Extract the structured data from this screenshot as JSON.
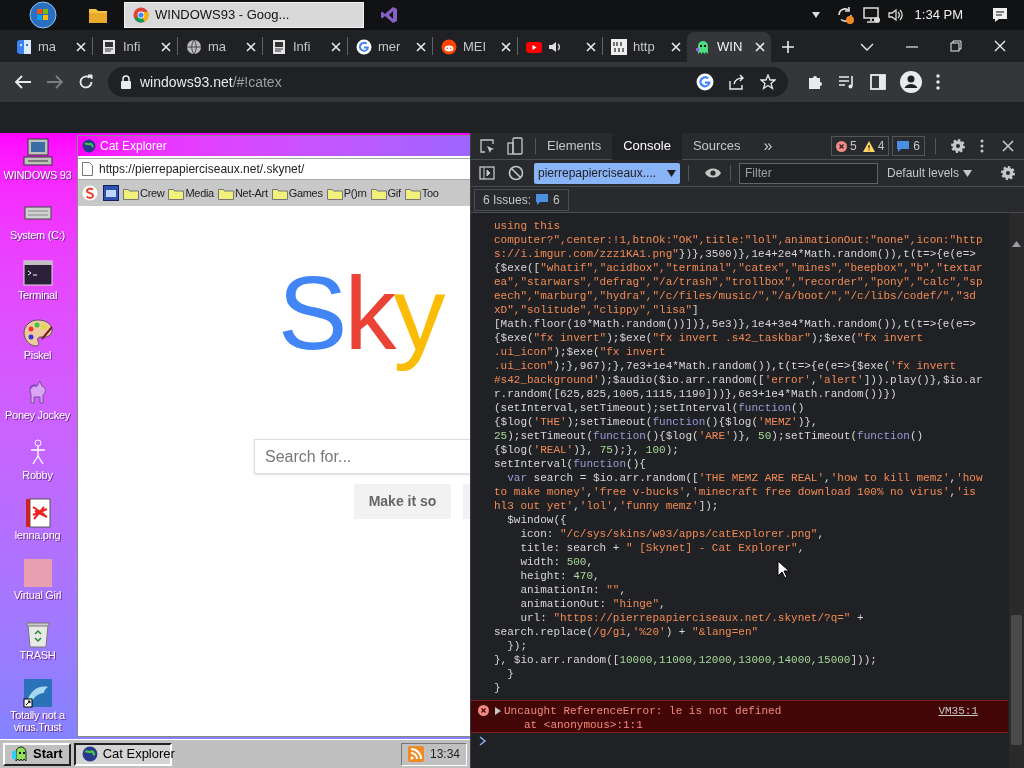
{
  "os_taskbar": {
    "window_button": "WINDOWS93 - Goog...",
    "clock": "1:34 PM"
  },
  "browser": {
    "tabs": [
      {
        "label": "ma",
        "kind": "finder",
        "audio": false,
        "selected": false
      },
      {
        "label": "Infi",
        "kind": "book",
        "audio": false,
        "selected": false
      },
      {
        "label": "ma",
        "kind": "globe",
        "audio": false,
        "selected": false
      },
      {
        "label": "Infi",
        "kind": "book",
        "audio": false,
        "selected": false
      },
      {
        "label": "mer",
        "kind": "google",
        "audio": false,
        "selected": false
      },
      {
        "label": "MEI",
        "kind": "reddit",
        "audio": false,
        "selected": false
      },
      {
        "kind": "youtube",
        "audio": true,
        "selected": false
      },
      {
        "label": "http",
        "kind": "binary",
        "audio": false,
        "selected": false
      },
      {
        "label": "WIN",
        "kind": "ghost",
        "audio": false,
        "selected": true
      }
    ],
    "address": {
      "host": "windows93.net",
      "path": "/#!catex"
    }
  },
  "desktop": {
    "icons": [
      {
        "label": "WINDOWS 93",
        "kind": "computer"
      },
      {
        "label": "System (C:)",
        "kind": "drive"
      },
      {
        "label": "Terminal",
        "kind": "terminal"
      },
      {
        "label": "Piskel",
        "kind": "palette"
      },
      {
        "label": "Poney Jockey",
        "kind": "pony"
      },
      {
        "label": "Robby",
        "kind": "robot"
      },
      {
        "label": "lenna.png",
        "kind": "image"
      },
      {
        "label": "Virtual Girl",
        "kind": "photo"
      },
      {
        "label": "TRASH",
        "kind": "trash"
      },
      {
        "label": "Totally not a virus.Trust",
        "kind": "dolphin"
      }
    ]
  },
  "cat_explorer": {
    "title": "Cat Explorer",
    "url": "https://pierrepapierciseaux.net/.skynet/",
    "bookmarks": [
      {
        "kind": "s-logo"
      },
      {
        "kind": "app"
      },
      {
        "kind": "folder",
        "label": "Crew"
      },
      {
        "kind": "folder",
        "label": "Media"
      },
      {
        "kind": "folder",
        "label": "Net-Art"
      },
      {
        "kind": "folder",
        "label": "Games"
      },
      {
        "kind": "folder",
        "label": "P()rn"
      },
      {
        "kind": "folder",
        "label": "Gif"
      },
      {
        "kind": "folder",
        "label": "Too"
      }
    ],
    "page": {
      "logo": [
        {
          "text": "S",
          "color": "#4285f4"
        },
        {
          "text": "k",
          "color": "#ea4335"
        },
        {
          "text": "y",
          "color": "#fbbc05"
        }
      ],
      "search_placeholder": "Search for...",
      "button": "Make it so"
    }
  },
  "taskbar": {
    "start": "Start",
    "tasks": [
      {
        "label": "Cat Explorer",
        "selected": true
      }
    ],
    "clock": "13:34"
  },
  "devtools": {
    "tabs": [
      {
        "label": "Elements",
        "selected": false
      },
      {
        "label": "Console",
        "selected": true
      },
      {
        "label": "Sources",
        "selected": false
      }
    ],
    "more": "»",
    "errors": "5",
    "warnings": "4",
    "messages": "6",
    "context": "pierrepapierciseaux....",
    "filter_placeholder": "Filter",
    "levels": "Default levels",
    "issues_label": "6 Issues:",
    "issues_count": "6",
    "console_lines": [
      [
        {
          "kind": "s",
          "text": "using this"
        }
      ],
      [
        {
          "kind": "s",
          "text": "computer?\",center:!1,btnOk:\"OK\",title:\"lol\",animationOut:\"none\",icon:\"http"
        }
      ],
      [
        {
          "kind": "s",
          "text": "s://i.imgur.com/zzz1KA1.png\""
        },
        {
          "kind": "p",
          "text": "})},3500)},1e4+2e4*Math.random()),t(t=>{e(e=>"
        }
      ],
      [
        {
          "kind": "p",
          "text": "{$exe(["
        },
        {
          "kind": "s",
          "text": "\"whatif\",\"acidbox\",\"terminal\",\"catex\",\"mines\",\"beepbox\",\"b\",\"textar"
        }
      ],
      [
        {
          "kind": "s",
          "text": "ea\",\"starwars\",\"defrag\",\"/a/trash\",\"trollbox\",\"recorder\",\"pony\",\"calc\",\"sp"
        }
      ],
      [
        {
          "kind": "s",
          "text": "eech\",\"marburg\",\"hydra\",\"/c/files/music/\",\"/a/boot/\",\"/c/libs/codef/\",\"3d"
        }
      ],
      [
        {
          "kind": "s",
          "text": "xD\",\"solitude\",\"clippy\",\"lisa\""
        },
        {
          "kind": "p",
          "text": "]"
        }
      ],
      [
        {
          "kind": "p",
          "text": "[Math.floor(10*Math.random())])},5e3)},1e4+3e4*Math.random()),t(t=>{e(e=>"
        }
      ],
      [
        {
          "kind": "p",
          "text": "{$exe("
        },
        {
          "kind": "s",
          "text": "\"fx invert\""
        },
        {
          "kind": "p",
          "text": ");$exe("
        },
        {
          "kind": "s",
          "text": "\"fx invert .s42_taskbar\""
        },
        {
          "kind": "p",
          "text": ");$exe("
        },
        {
          "kind": "s",
          "text": "\"fx invert"
        }
      ],
      [
        {
          "kind": "s",
          "text": ".ui_icon\""
        },
        {
          "kind": "p",
          "text": ");$exe("
        },
        {
          "kind": "s",
          "text": "\"fx invert"
        }
      ],
      [
        {
          "kind": "s",
          "text": ".ui_icon\""
        },
        {
          "kind": "p",
          "text": ");},967);},7e3+1e4*Math.random()),t(t=>{e(e=>{$exe("
        },
        {
          "kind": "s",
          "text": "'fx invert"
        }
      ],
      [
        {
          "kind": "s",
          "text": "#s42_background'"
        },
        {
          "kind": "p",
          "text": ");$audio($io.arr.random(["
        },
        {
          "kind": "s",
          "text": "'error'"
        },
        {
          "kind": "p",
          "text": ","
        },
        {
          "kind": "s",
          "text": "'alert'"
        },
        {
          "kind": "p",
          "text": "])).play()},$io.ar"
        }
      ],
      [
        {
          "kind": "p",
          "text": "r.random([625,825,1005,1115,1190]))},6e3+1e4*Math.random())})"
        }
      ],
      [
        {
          "kind": "p",
          "text": "(setInterval,setTimeout);setInterval("
        },
        {
          "kind": "k",
          "text": "function"
        },
        {
          "kind": "p",
          "text": "()"
        }
      ],
      [
        {
          "kind": "p",
          "text": "{$log("
        },
        {
          "kind": "s",
          "text": "'THE'"
        },
        {
          "kind": "p",
          "text": ");setTimeout("
        },
        {
          "kind": "k",
          "text": "function"
        },
        {
          "kind": "p",
          "text": "(){$log("
        },
        {
          "kind": "s",
          "text": "'MEMZ'"
        },
        {
          "kind": "p",
          "text": ")},"
        }
      ],
      [
        {
          "kind": "n",
          "text": "25"
        },
        {
          "kind": "p",
          "text": ");setTimeout("
        },
        {
          "kind": "k",
          "text": "function"
        },
        {
          "kind": "p",
          "text": "(){$log("
        },
        {
          "kind": "s",
          "text": "'ARE'"
        },
        {
          "kind": "p",
          "text": ")}, "
        },
        {
          "kind": "n",
          "text": "50"
        },
        {
          "kind": "p",
          "text": ");setTimeout("
        },
        {
          "kind": "k",
          "text": "function"
        },
        {
          "kind": "p",
          "text": "()"
        }
      ],
      [
        {
          "kind": "p",
          "text": "{$log("
        },
        {
          "kind": "s",
          "text": "'REAL'"
        },
        {
          "kind": "p",
          "text": ")}, "
        },
        {
          "kind": "n",
          "text": "75"
        },
        {
          "kind": "p",
          "text": ");}, "
        },
        {
          "kind": "n",
          "text": "100"
        },
        {
          "kind": "p",
          "text": ");"
        }
      ],
      [
        {
          "kind": "p",
          "text": "setInterval("
        },
        {
          "kind": "k",
          "text": "function"
        },
        {
          "kind": "p",
          "text": "(){"
        }
      ],
      [
        {
          "kind": "k",
          "text": "  var"
        },
        {
          "kind": "p",
          "text": " search = $io.arr.random(["
        },
        {
          "kind": "s",
          "text": "'THE MEMZ ARE REAL'"
        },
        {
          "kind": "p",
          "text": ","
        },
        {
          "kind": "s",
          "text": "'how to kill memz'"
        },
        {
          "kind": "p",
          "text": ","
        },
        {
          "kind": "s",
          "text": "'how"
        }
      ],
      [
        {
          "kind": "s",
          "text": "to make money'"
        },
        {
          "kind": "p",
          "text": ","
        },
        {
          "kind": "s",
          "text": "'free v-bucks'"
        },
        {
          "kind": "p",
          "text": ","
        },
        {
          "kind": "s",
          "text": "'minecraft free download 100% no virus'"
        },
        {
          "kind": "p",
          "text": ","
        },
        {
          "kind": "s",
          "text": "'is"
        }
      ],
      [
        {
          "kind": "s",
          "text": "hl3 out yet'"
        },
        {
          "kind": "p",
          "text": ","
        },
        {
          "kind": "s",
          "text": "'lol'"
        },
        {
          "kind": "p",
          "text": ","
        },
        {
          "kind": "s",
          "text": "'funny memz'"
        },
        {
          "kind": "p",
          "text": "]);"
        }
      ],
      [
        {
          "kind": "p",
          "text": "  $window({"
        }
      ],
      [
        {
          "kind": "p",
          "text": "    icon: "
        },
        {
          "kind": "s",
          "text": "\"/c/sys/skins/w93/apps/catExplorer.png\""
        },
        {
          "kind": "p",
          "text": ","
        }
      ],
      [
        {
          "kind": "p",
          "text": "    title: search + "
        },
        {
          "kind": "s",
          "text": "\" [Skynet] - Cat Explorer\""
        },
        {
          "kind": "p",
          "text": ","
        }
      ],
      [
        {
          "kind": "p",
          "text": "    width: "
        },
        {
          "kind": "n",
          "text": "500"
        },
        {
          "kind": "p",
          "text": ","
        }
      ],
      [
        {
          "kind": "p",
          "text": "    height: "
        },
        {
          "kind": "n",
          "text": "470"
        },
        {
          "kind": "p",
          "text": ","
        }
      ],
      [
        {
          "kind": "p",
          "text": "    animationIn: "
        },
        {
          "kind": "s",
          "text": "\"\""
        },
        {
          "kind": "p",
          "text": ","
        }
      ],
      [
        {
          "kind": "p",
          "text": "    animationOut: "
        },
        {
          "kind": "s",
          "text": "\"hinge\""
        },
        {
          "kind": "p",
          "text": ","
        }
      ],
      [
        {
          "kind": "p",
          "text": "    url: "
        },
        {
          "kind": "s",
          "text": "\"https://pierrepapierciseaux.net/.skynet/?q=\""
        },
        {
          "kind": "p",
          "text": " +"
        }
      ],
      [
        {
          "kind": "p",
          "text": "search.replace("
        },
        {
          "kind": "s",
          "text": "/g/gi"
        },
        {
          "kind": "p",
          "text": ","
        },
        {
          "kind": "s",
          "text": "'%20'"
        },
        {
          "kind": "p",
          "text": ") + "
        },
        {
          "kind": "s",
          "text": "\"&lang=en\""
        }
      ],
      [
        {
          "kind": "p",
          "text": "  });"
        }
      ],
      [
        {
          "kind": "p",
          "text": "}, $io.arr.random(["
        },
        {
          "kind": "n",
          "text": "10000,11000,12000,13000,14000,15000"
        },
        {
          "kind": "p",
          "text": "]));"
        }
      ],
      [
        {
          "kind": "p",
          "text": "  }"
        }
      ],
      [
        {
          "kind": "p",
          "text": "}"
        }
      ]
    ],
    "error": {
      "message": "Uncaught ReferenceError: le is not defined",
      "trace": "at <anonymous>:1:1",
      "source": "VM35:1"
    }
  }
}
